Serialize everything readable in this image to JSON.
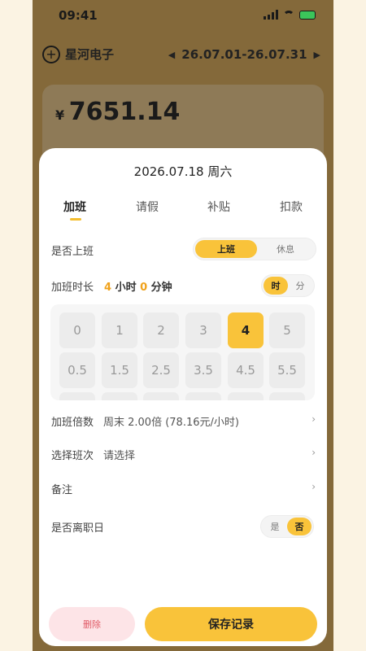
{
  "status_bar": {
    "time": "09:41"
  },
  "header": {
    "company": "星河电子",
    "period": "26.07.01-26.07.31"
  },
  "summary": {
    "currency": "¥",
    "amount": "7651.14"
  },
  "sheet": {
    "date_title": "2026.07.18  周六",
    "tabs": [
      {
        "label": "加班",
        "active": true
      },
      {
        "label": "请假",
        "active": false
      },
      {
        "label": "补贴",
        "active": false
      },
      {
        "label": "扣款",
        "active": false
      }
    ],
    "work_status": {
      "label": "是否上班",
      "options": [
        "上班",
        "休息"
      ],
      "selected": "上班"
    },
    "overtime_duration": {
      "label": "加班时长",
      "hours": "4",
      "hours_unit": " 小时 ",
      "minutes": "0",
      "minutes_unit": " 分钟",
      "unit_options": [
        "时",
        "分"
      ],
      "unit_selected": "时"
    },
    "hour_chips": [
      "0",
      "1",
      "2",
      "3",
      "4",
      "5",
      "0.5",
      "1.5",
      "2.5",
      "3.5",
      "4.5",
      "5.5"
    ],
    "hour_selected": "4",
    "rate": {
      "label": "加班倍数",
      "value": "周末 2.00倍 (78.16元/小时)"
    },
    "shift": {
      "label": "选择班次",
      "placeholder": "请选择"
    },
    "note": {
      "label": "备注",
      "value": ""
    },
    "resign_day": {
      "label": "是否离职日",
      "options": [
        "是",
        "否"
      ],
      "selected": "否"
    },
    "delete_label": "删除",
    "save_label": "保存记录"
  },
  "colors": {
    "accent": "#f9c33a",
    "highlight": "#f0a21b",
    "danger": "#e05a66"
  }
}
